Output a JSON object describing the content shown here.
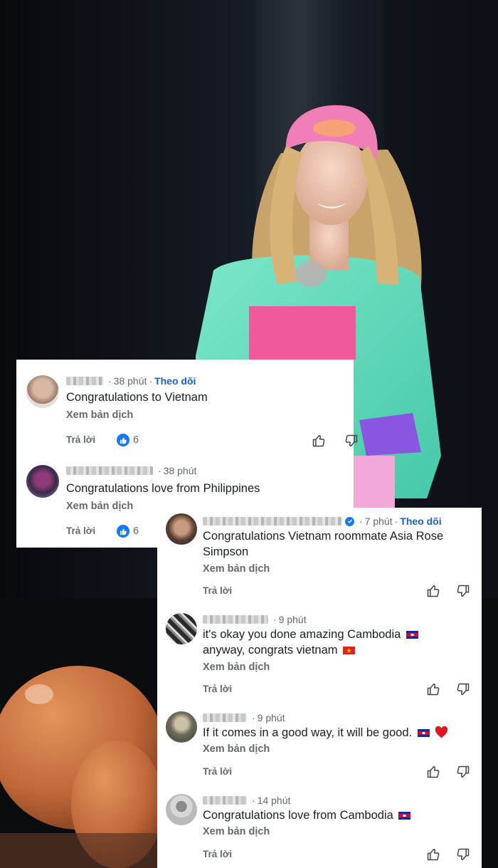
{
  "card1": {
    "comments": [
      {
        "time": "38 phút",
        "follow": "Theo dõi",
        "text": "Congratulations to Vietnam",
        "translate": "Xem bản dịch",
        "reply": "Trả lời",
        "likes": "6"
      },
      {
        "time": "38 phút",
        "text": "Congratulations love from Philippines",
        "translate": "Xem bản dịch",
        "reply": "Trả lời",
        "likes": "6"
      }
    ]
  },
  "card2": {
    "comments": [
      {
        "time": "7 phút",
        "follow": "Theo dõi",
        "text_line1": "Congratulations Vietnam roommate Asia Rose",
        "text_line2": "Simpson",
        "translate": "Xem bản dịch",
        "reply": "Trả lời"
      },
      {
        "time": "9 phút",
        "text_line1": "it's okay you done amazing Cambodia",
        "text_line2": "anyway, congrats vietnam",
        "translate": "Xem bản dịch",
        "reply": "Trả lời"
      },
      {
        "time": "9 phút",
        "text": "If it comes in a good way, it will be good.",
        "translate": "Xem bản dịch",
        "reply": "Trả lời"
      },
      {
        "time": "14 phút",
        "text": "Congratulations love from Cambodia",
        "translate": "Xem bản dịch",
        "reply": "Trả lời"
      }
    ]
  },
  "sep": "·",
  "colors": {
    "follow": "#1a5fc4",
    "like": "#1877f2",
    "muted": "#65676b"
  },
  "icons": [
    "thumbs-up-icon",
    "thumbs-down-icon",
    "verified-badge-icon",
    "cambodia-flag-icon",
    "vietnam-flag-icon",
    "red-heart-icon"
  ]
}
